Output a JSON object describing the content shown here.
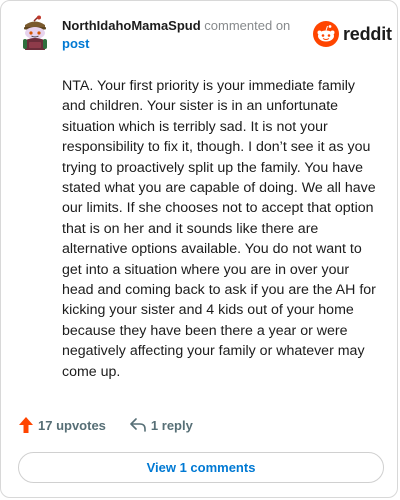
{
  "header": {
    "username": "NorthIdahoMamaSpud",
    "action_text": " commented on",
    "post_label": "post",
    "avatar_icon": "snoo-avatar-icon",
    "brand": {
      "icon": "reddit-snoo-icon",
      "name": "reddit",
      "color": "#ff4500"
    }
  },
  "comment": {
    "text": "NTA. Your first priority is your immediate family and children. Your sister is in an unfortunate situation which is terribly sad. It is not your responsibility to fix it, though. I don’t see it as you trying to proactively split up the family. You have stated what you are capable of doing. We all have our limits. If she chooses not to accept that option that is on her and it sounds like there are alternative options available. You do not want to get into a situation where you are in over your head and coming back to ask if you are the AH for kicking your sister and 4 kids out of your home because they have been there a year or were negatively affecting your family or whatever may come up."
  },
  "actions": {
    "upvotes_label": "17 upvotes",
    "upvote_icon": "upvote-arrow-icon",
    "upvote_color": "#ff4500",
    "reply_label": "1 reply",
    "reply_icon": "reply-arrow-icon"
  },
  "footer": {
    "view_comments_label": "View 1 comments",
    "link_color": "#0079d3"
  }
}
